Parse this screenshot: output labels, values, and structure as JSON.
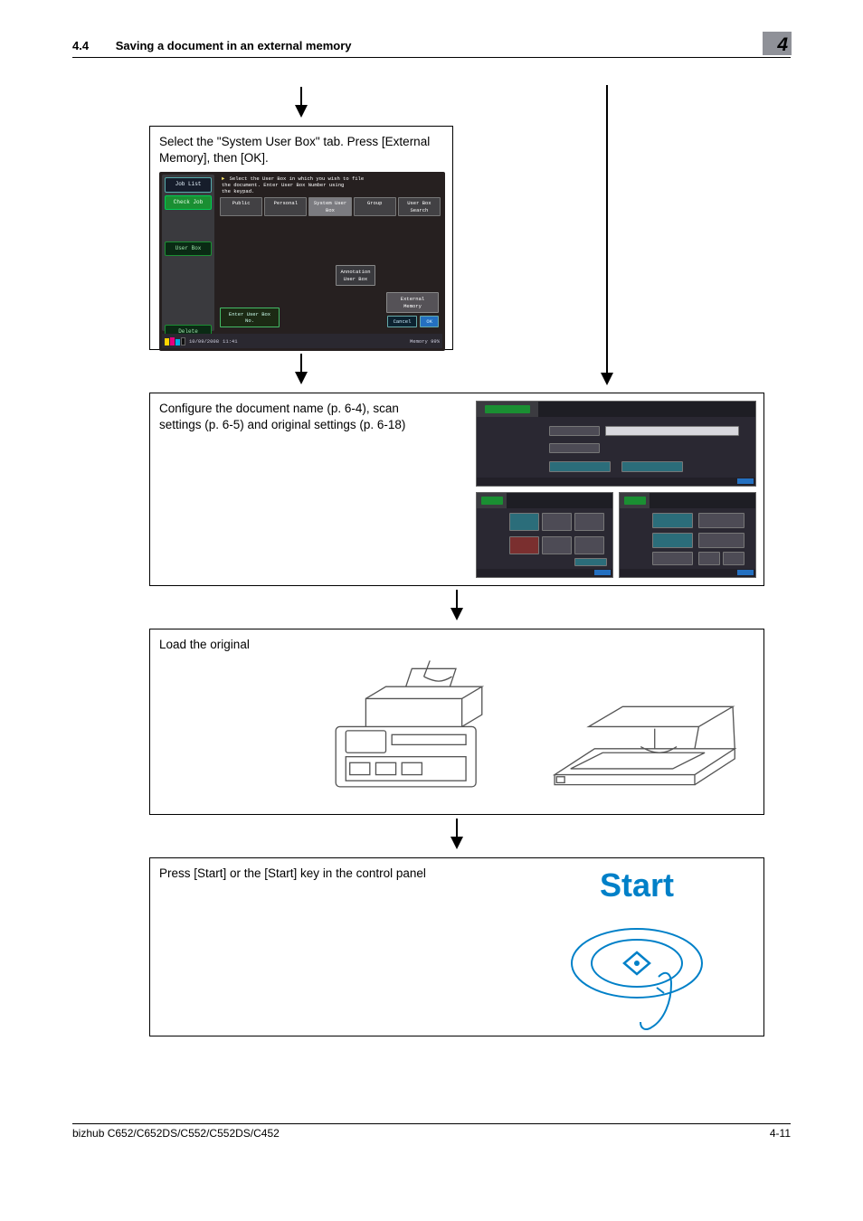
{
  "header": {
    "section_num": "4.4",
    "section_title": "Saving a document in an external memory",
    "chapter_badge": "4"
  },
  "footer": {
    "product_line": "bizhub C652/C652DS/C552/C552DS/C452",
    "page_num": "4-11"
  },
  "steps": {
    "s1": {
      "text": "Select the \"System User Box\" tab. Press [External Memory], then [OK]."
    },
    "s2": {
      "text": "Configure the document name (p. 6-4), scan settings (p. 6-5) and original settings (p. 6-18)"
    },
    "s3": {
      "text": "Load the original"
    },
    "s4": {
      "text": "Press [Start] or the [Start] key in the control panel",
      "button_label": "Start"
    }
  },
  "panel": {
    "side": {
      "job_list": "Job List",
      "check_job": "Check Job",
      "user_box": "User Box",
      "delete": "Delete"
    },
    "instr_l1": "Select the User Box in which you wish to file",
    "instr_l2": "the document.  Enter User Box Number using",
    "instr_l3": "the keypad.",
    "tabs": {
      "public": "Public",
      "personal": "Personal",
      "system": "System User Box",
      "group": "Group",
      "search": "User Box Search"
    },
    "chips": {
      "annotation": "Annotation User Box",
      "external": "External Memory",
      "enter_box_no": "Enter User Box No."
    },
    "buttons": {
      "cancel": "Cancel",
      "ok": "OK"
    },
    "status": {
      "date": "10/09/2008",
      "time": "11:41",
      "mem_label": "Memory",
      "mem_value": "99%"
    }
  },
  "icons": {
    "arrow_down": "arrow-down-icon",
    "start_diamond": "start-diamond-icon"
  },
  "colors": {
    "accent_blue": "#0080c8",
    "panel_bg": "#262020",
    "side_badge": "#8f9198",
    "tab_green": "#1a8f32"
  }
}
